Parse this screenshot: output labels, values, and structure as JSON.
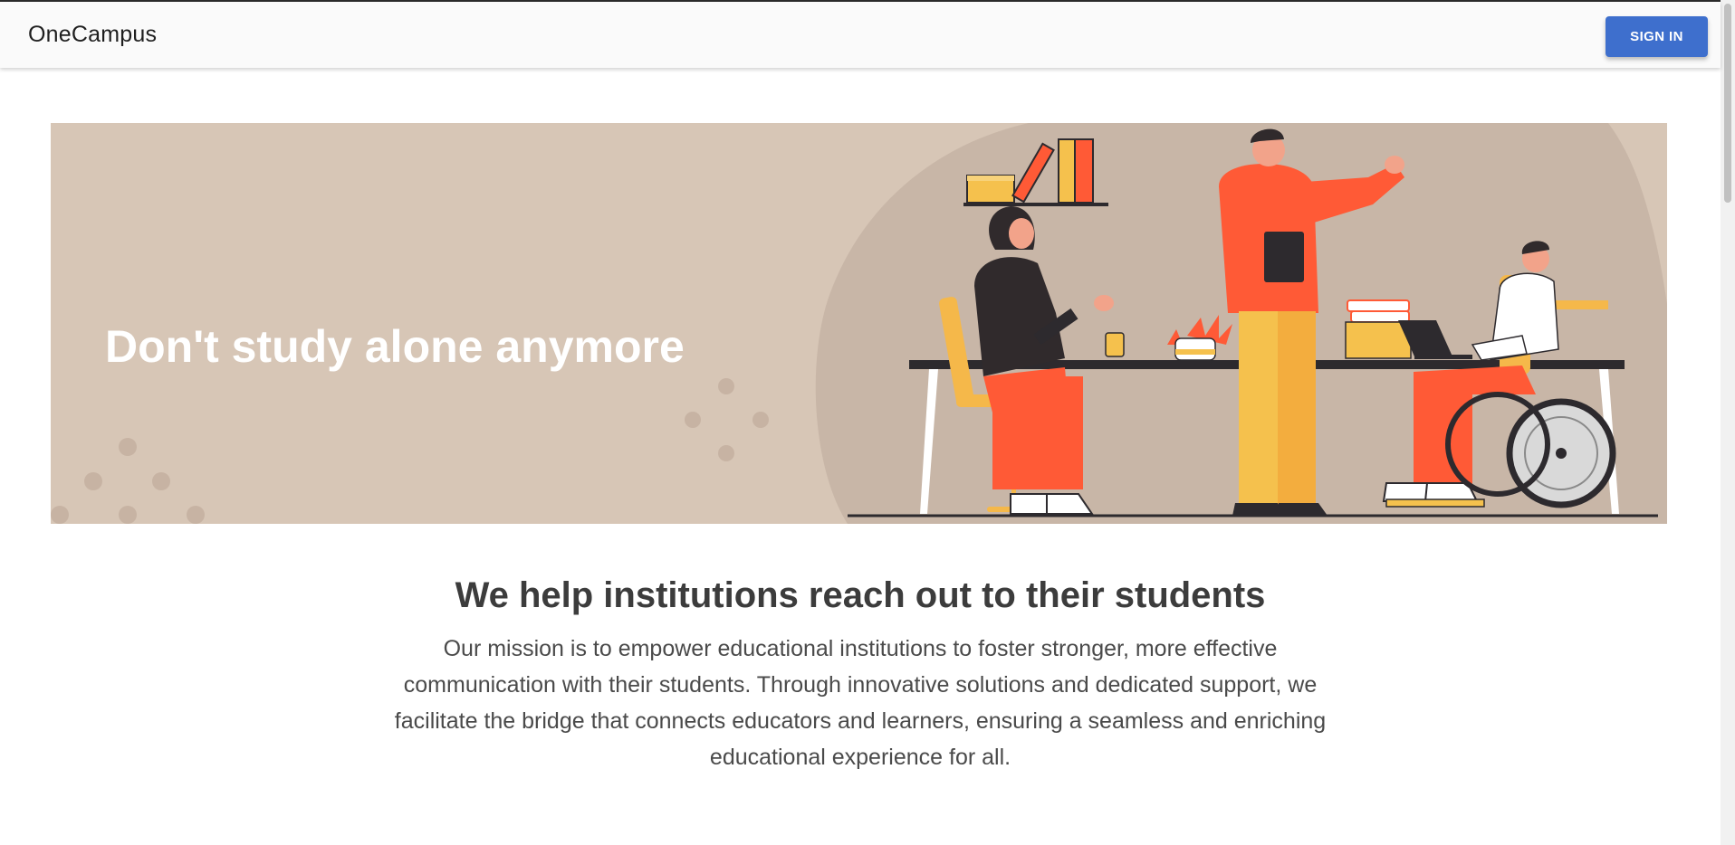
{
  "header": {
    "brand": "OneCampus",
    "signin_label": "SIGN IN"
  },
  "hero": {
    "title": "Don't study alone anymore",
    "background_color": "#d7c6b6",
    "illustration": "team-study-illustration"
  },
  "about": {
    "heading": "We help institutions reach out to their students",
    "body": "Our mission is to empower educational institutions to foster stronger, more effective communication with their students. Through innovative solutions and dedicated support, we facilitate the bridge that connects educators and learners, ensuring a seamless and enriching educational experience for all."
  },
  "colors": {
    "primary": "#3e6fcd",
    "accent_orange": "#ff5a36",
    "accent_yellow": "#f5b84a"
  }
}
